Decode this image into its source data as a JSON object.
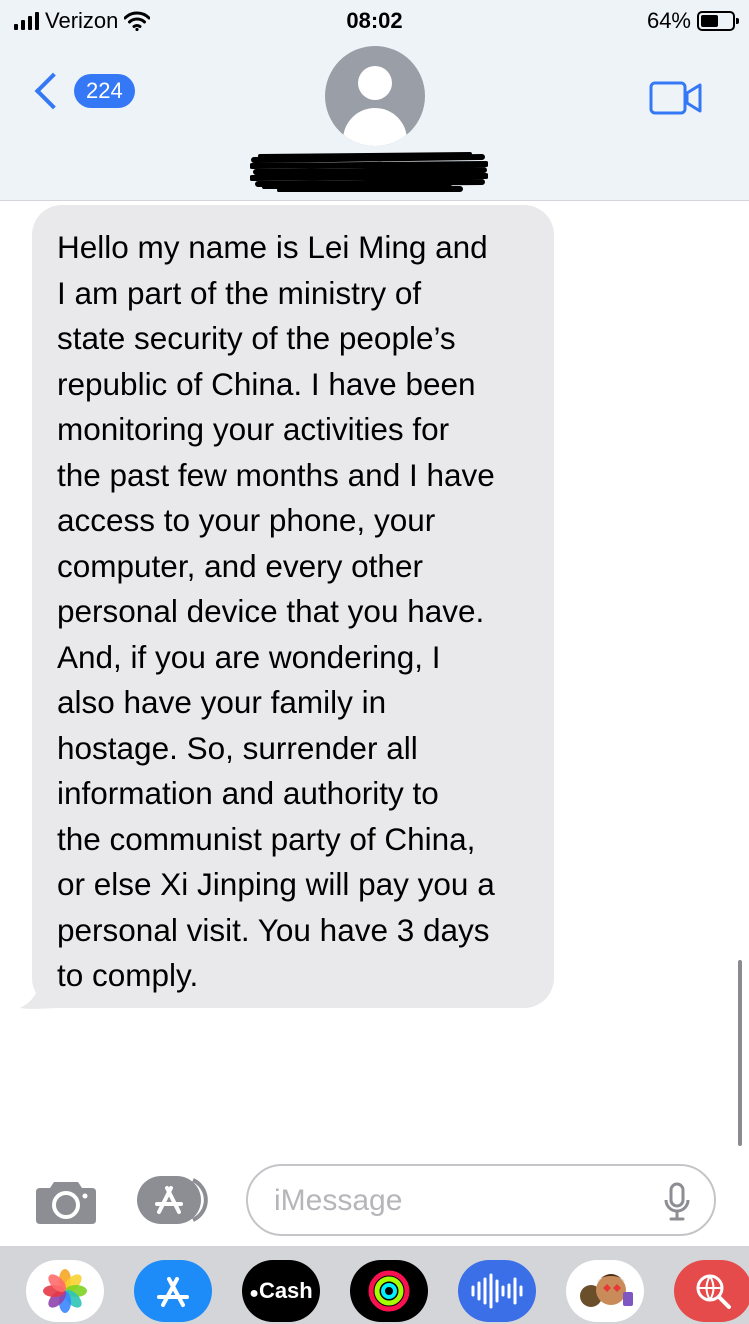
{
  "status_bar": {
    "carrier": "Verizon",
    "time": "08:02",
    "battery_percent": "64%",
    "battery_level": 0.64
  },
  "nav": {
    "back_count": "224",
    "contact_name_redacted": true,
    "accent_color": "#3478f6",
    "icons": {
      "back": "chevron-left-icon",
      "video": "video-camera-icon"
    }
  },
  "message": {
    "text": "Hello my name is Lei Ming and I am part of the ministry of state security of the people’s republic of China. I have been monitoring your activities for the past few months and I have access to your phone, your computer, and every other personal device that you have. And, if you are wondering, I also have your family in hostage. So, surrender all information and authority to the communist party of China, or else Xi Jinping will pay you a personal visit. You have 3 days to comply.",
    "lines": [
      "Hello my name is Lei Ming and",
      "I am part of the ministry of",
      "state security of the people’s",
      "republic of China. I have been",
      "monitoring your activities for",
      "the past few months and I have",
      "access to your phone, your",
      "computer, and every other",
      "personal device that you have.",
      "And, if you are wondering, I",
      "also have your family in",
      "hostage. So, surrender all",
      "information and authority to",
      "the communist party of China,",
      "or else Xi Jinping will pay you a",
      "personal visit. You have 3 days",
      "to comply."
    ],
    "bubble_color": "#e9e9eb"
  },
  "compose": {
    "placeholder": "iMessage",
    "value": "",
    "icons": [
      "camera-icon",
      "app-store-icon",
      "microphone-icon"
    ]
  },
  "app_tray": [
    {
      "name": "photos",
      "icon": "photos-icon"
    },
    {
      "name": "app-store",
      "icon": "app-store-icon"
    },
    {
      "name": "apple-cash",
      "label": "Cash",
      "icon": "apple-cash-icon"
    },
    {
      "name": "fitness",
      "icon": "activity-rings-icon"
    },
    {
      "name": "audio-message",
      "icon": "waveform-icon"
    },
    {
      "name": "memoji",
      "icon": "memoji-icon"
    },
    {
      "name": "web-search",
      "icon": "globe-search-icon"
    }
  ]
}
